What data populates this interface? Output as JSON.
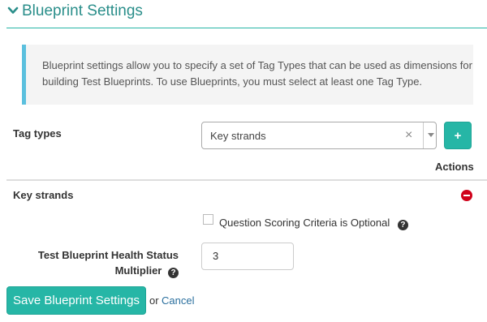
{
  "section": {
    "title": "Blueprint Settings"
  },
  "info": {
    "line1": "Blueprint settings allow you to specify a set of Tag Types that can be used as dimensions for",
    "line2": "building Test Blueprints. To use Blueprints, you must select at least one Tag Type."
  },
  "tag_types": {
    "label": "Tag types",
    "selected_value": "Key strands",
    "clear_glyph": "×",
    "add_label": "+"
  },
  "table": {
    "actions_header": "Actions",
    "row": {
      "name": "Key strands"
    }
  },
  "scoring": {
    "checked": false,
    "label": "Question Scoring Criteria is Optional",
    "help_glyph": "?"
  },
  "multiplier": {
    "label_line1": "Test Blueprint Health Status",
    "label_line2": "Multiplier",
    "help_glyph": "?",
    "value": "3"
  },
  "footer": {
    "save_label": "Save Blueprint Settings",
    "or_text": "or",
    "cancel_label": "Cancel"
  },
  "colors": {
    "accent": "#26b6a6",
    "title": "#2a8e8a",
    "info_border": "#5bc0de",
    "danger": "#d0021b",
    "link": "#2a6f9e"
  }
}
